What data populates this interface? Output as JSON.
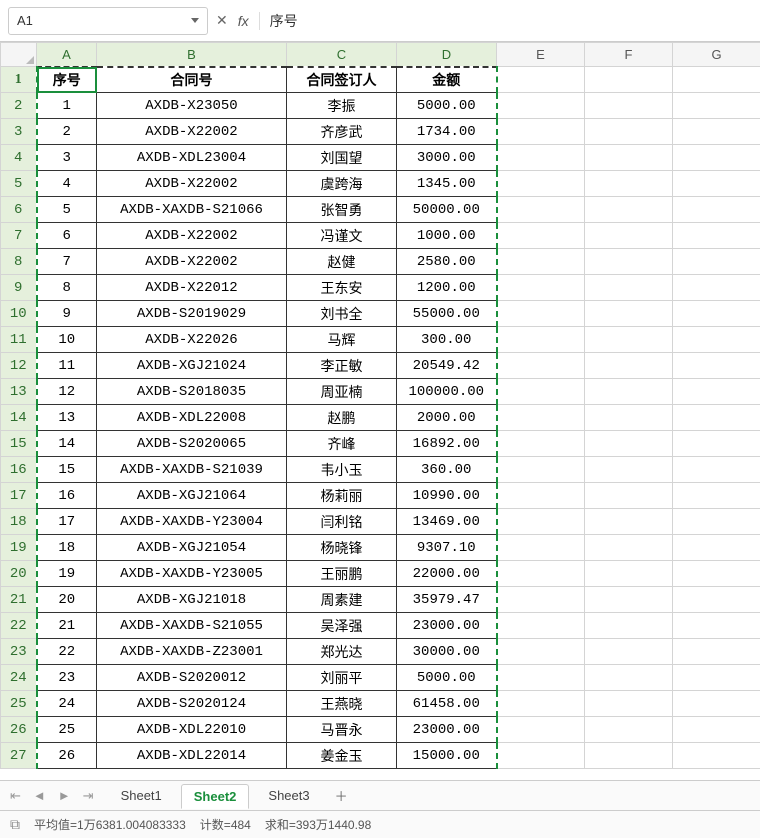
{
  "formula_bar": {
    "name_box": "A1",
    "fx_label": "fx",
    "value": "序号"
  },
  "col_headers": [
    "A",
    "B",
    "C",
    "D",
    "E",
    "F",
    "G"
  ],
  "selected_col_count": 4,
  "visible_rows": 27,
  "table": {
    "headers": [
      "序号",
      "合同号",
      "合同签订人",
      "金额"
    ],
    "rows": [
      [
        "1",
        "AXDB-X23050",
        "李振",
        "5000.00"
      ],
      [
        "2",
        "AXDB-X22002",
        "齐彦武",
        "1734.00"
      ],
      [
        "3",
        "AXDB-XDL23004",
        "刘国望",
        "3000.00"
      ],
      [
        "4",
        "AXDB-X22002",
        "虞跨海",
        "1345.00"
      ],
      [
        "5",
        "AXDB-XAXDB-S21066",
        "张智勇",
        "50000.00"
      ],
      [
        "6",
        "AXDB-X22002",
        "冯谨文",
        "1000.00"
      ],
      [
        "7",
        "AXDB-X22002",
        "赵健",
        "2580.00"
      ],
      [
        "8",
        "AXDB-X22012",
        "王东安",
        "1200.00"
      ],
      [
        "9",
        "AXDB-S2019029",
        "刘书全",
        "55000.00"
      ],
      [
        "10",
        "AXDB-X22026",
        "马辉",
        "300.00"
      ],
      [
        "11",
        "AXDB-XGJ21024",
        "李正敏",
        "20549.42"
      ],
      [
        "12",
        "AXDB-S2018035",
        "周亚楠",
        "100000.00"
      ],
      [
        "13",
        "AXDB-XDL22008",
        "赵鹏",
        "2000.00"
      ],
      [
        "14",
        "AXDB-S2020065",
        "齐峰",
        "16892.00"
      ],
      [
        "15",
        "AXDB-XAXDB-S21039",
        "韦小玉",
        "360.00"
      ],
      [
        "16",
        "AXDB-XGJ21064",
        "杨莉丽",
        "10990.00"
      ],
      [
        "17",
        "AXDB-XAXDB-Y23004",
        "闫利铭",
        "13469.00"
      ],
      [
        "18",
        "AXDB-XGJ21054",
        "杨晓锋",
        "9307.10"
      ],
      [
        "19",
        "AXDB-XAXDB-Y23005",
        "王丽鹏",
        "22000.00"
      ],
      [
        "20",
        "AXDB-XGJ21018",
        "周素建",
        "35979.47"
      ],
      [
        "21",
        "AXDB-XAXDB-S21055",
        "吴泽强",
        "23000.00"
      ],
      [
        "22",
        "AXDB-XAXDB-Z23001",
        "郑光达",
        "30000.00"
      ],
      [
        "23",
        "AXDB-S2020012",
        "刘丽平",
        "5000.00"
      ],
      [
        "24",
        "AXDB-S2020124",
        "王燕晓",
        "61458.00"
      ],
      [
        "25",
        "AXDB-XDL22010",
        "马晋永",
        "23000.00"
      ],
      [
        "26",
        "AXDB-XDL22014",
        "姜金玉",
        "15000.00"
      ]
    ]
  },
  "tabs": {
    "items": [
      "Sheet1",
      "Sheet2",
      "Sheet3"
    ],
    "active_index": 1
  },
  "status": {
    "avg_label": "平均值=",
    "avg_value": "1万6381.004083333",
    "count_label": "计数=",
    "count_value": "484",
    "sum_label": "求和=",
    "sum_value": "393万1440.98"
  }
}
